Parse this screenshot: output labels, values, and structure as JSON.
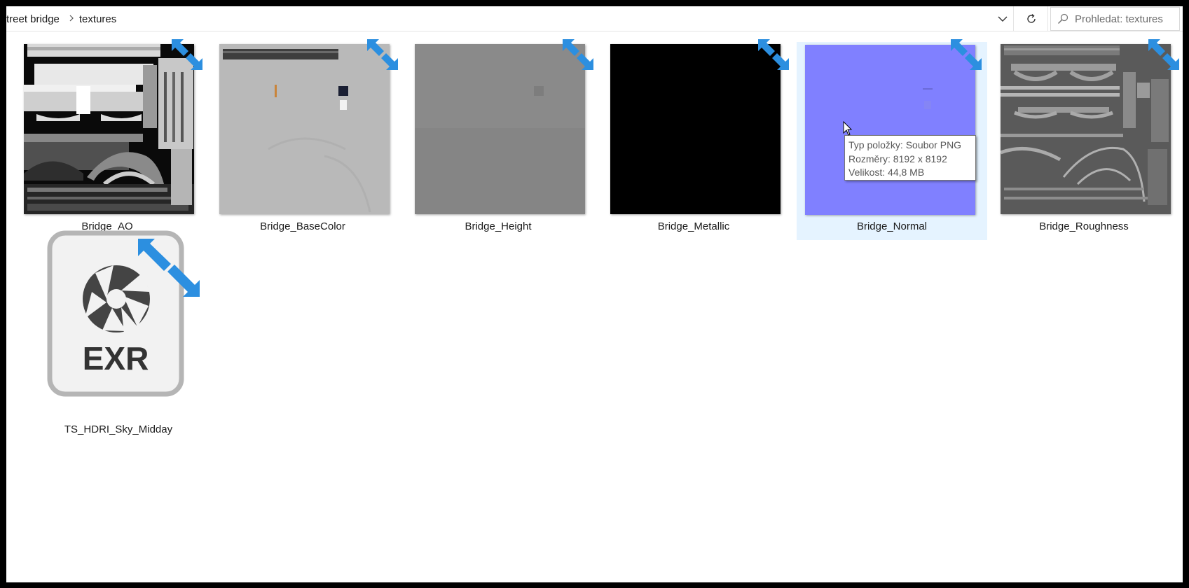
{
  "address_bar": {
    "breadcrumbs": [
      "treet bridge",
      "textures"
    ],
    "search_placeholder": "Prohledat: textures"
  },
  "files": [
    {
      "name": "Bridge_AO",
      "selected": false,
      "thumb": "ao"
    },
    {
      "name": "Bridge_BaseColor",
      "selected": false,
      "thumb": "basecolor"
    },
    {
      "name": "Bridge_Height",
      "selected": false,
      "thumb": "height"
    },
    {
      "name": "Bridge_Metallic",
      "selected": false,
      "thumb": "metallic"
    },
    {
      "name": "Bridge_Normal",
      "selected": true,
      "thumb": "normal"
    },
    {
      "name": "Bridge_Roughness",
      "selected": false,
      "thumb": "roughness"
    },
    {
      "name": "TS_HDRI_Sky_Midday",
      "selected": false,
      "icon": "exr-file-icon",
      "icon_label": "EXR"
    }
  ],
  "tooltip": {
    "type_line": "Typ položky: Soubor PNG",
    "dimensions_line": "Rozměry: 8192 x 8192",
    "size_line": "Velikost: 44,8 MB"
  },
  "colors": {
    "selection": "#e5f3ff",
    "compress_arrow": "#2c8fe0",
    "normal_map": "#8080ff"
  }
}
